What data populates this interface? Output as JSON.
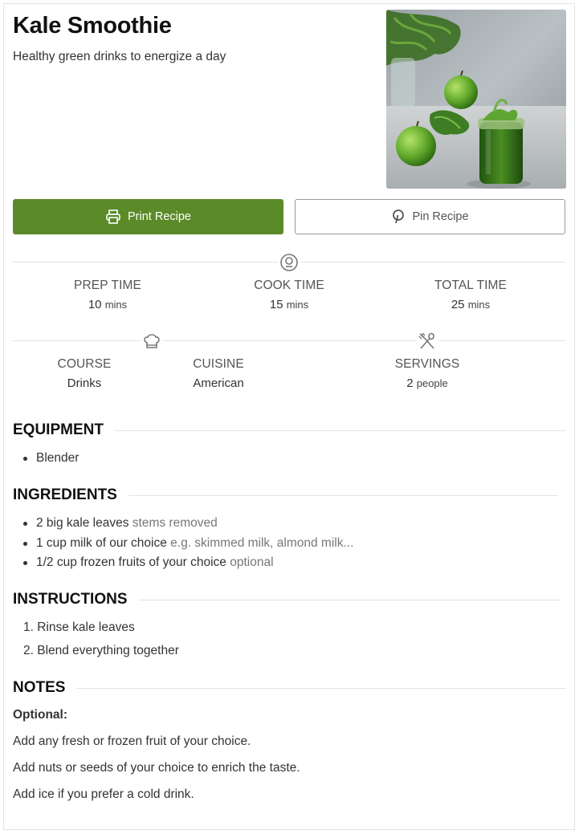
{
  "recipe": {
    "title": "Kale Smoothie",
    "summary": "Healthy green drinks to energize a day",
    "image_alt": "Kale smoothie in a jar with green apples",
    "brand_color": "#5b8a28"
  },
  "buttons": {
    "print_label": "Print Recipe",
    "print_icon": "printer-icon",
    "pin_label": "Pin Recipe",
    "pin_icon": "pinterest-icon"
  },
  "times": {
    "icon": "timer-icon",
    "prep": {
      "label": "PREP TIME",
      "value": "10",
      "unit": "mins"
    },
    "cook": {
      "label": "COOK TIME",
      "value": "15",
      "unit": "mins"
    },
    "total": {
      "label": "TOTAL TIME",
      "value": "25",
      "unit": "mins"
    }
  },
  "details": {
    "course_icon": "chef-hat-icon",
    "servings_icon": "fork-spoon-icon",
    "course": {
      "label": "COURSE",
      "value": "Drinks"
    },
    "cuisine": {
      "label": "CUISINE",
      "value": "American"
    },
    "servings": {
      "label": "SERVINGS",
      "value": "2",
      "unit": "people"
    }
  },
  "equipment": {
    "heading": "EQUIPMENT",
    "items": [
      "Blender"
    ]
  },
  "ingredients": {
    "heading": "INGREDIENTS",
    "items": [
      {
        "text": "2 big kale leaves",
        "note": "stems removed"
      },
      {
        "text": "1 cup milk of our choice",
        "note": "e.g. skimmed milk, almond milk..."
      },
      {
        "text": "1/2 cup frozen fruits of your choice",
        "note": "optional"
      }
    ]
  },
  "instructions": {
    "heading": "INSTRUCTIONS",
    "steps": [
      "1. Rinse kale leaves",
      "2. Blend everything together"
    ]
  },
  "notes": {
    "heading": "NOTES",
    "label": "Optional:",
    "lines": [
      "Add any fresh or frozen fruit of your choice.",
      "Add nuts or seeds of your choice to enrich the taste.",
      "Add ice if you prefer a cold drink."
    ]
  }
}
